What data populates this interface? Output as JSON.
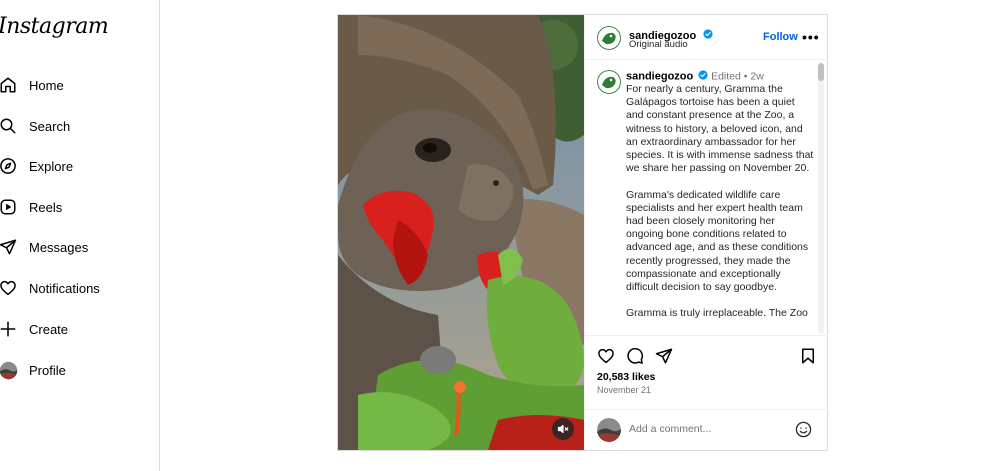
{
  "sidebar": {
    "logo": "Instagram",
    "items": [
      {
        "label": "Home",
        "icon": "home-icon"
      },
      {
        "label": "Search",
        "icon": "search-icon"
      },
      {
        "label": "Explore",
        "icon": "compass-icon"
      },
      {
        "label": "Reels",
        "icon": "reels-icon"
      },
      {
        "label": "Messages",
        "icon": "paper-plane-icon"
      },
      {
        "label": "Notifications",
        "icon": "heart-icon"
      },
      {
        "label": "Create",
        "icon": "plus-icon"
      },
      {
        "label": "Profile",
        "icon": "profile-avatar"
      }
    ]
  },
  "post": {
    "username": "sandiegozoo",
    "verified": true,
    "audio": "Original audio",
    "follow_label": "Follow",
    "more_label": "•••",
    "media_icon": "muted-speaker-icon",
    "caption": {
      "username": "sandiegozoo",
      "edited": "Edited",
      "separator": "•",
      "age": "2w",
      "text": "For nearly a century, Gramma the Galápagos tortoise has been a quiet and constant presence at the Zoo, a witness to history, a beloved icon, and an extraordinary ambassador for her species. It is with immense sadness that we share her passing on November 20.\n\nGramma's dedicated wildlife care specialists and her expert health team had been closely monitoring her ongoing bone conditions related to advanced age, and as these conditions recently progressed, they made the compassionate and exceptionally difficult decision to say goodbye.\n\nGramma is truly irreplaceable. The Zoo"
    },
    "likes": "20,583 likes",
    "date": "November 21",
    "comment_placeholder": "Add a comment...",
    "colors": {
      "accent": "#0064e0",
      "verified": "#0095f6",
      "logo_green": "#2e7d32"
    }
  }
}
